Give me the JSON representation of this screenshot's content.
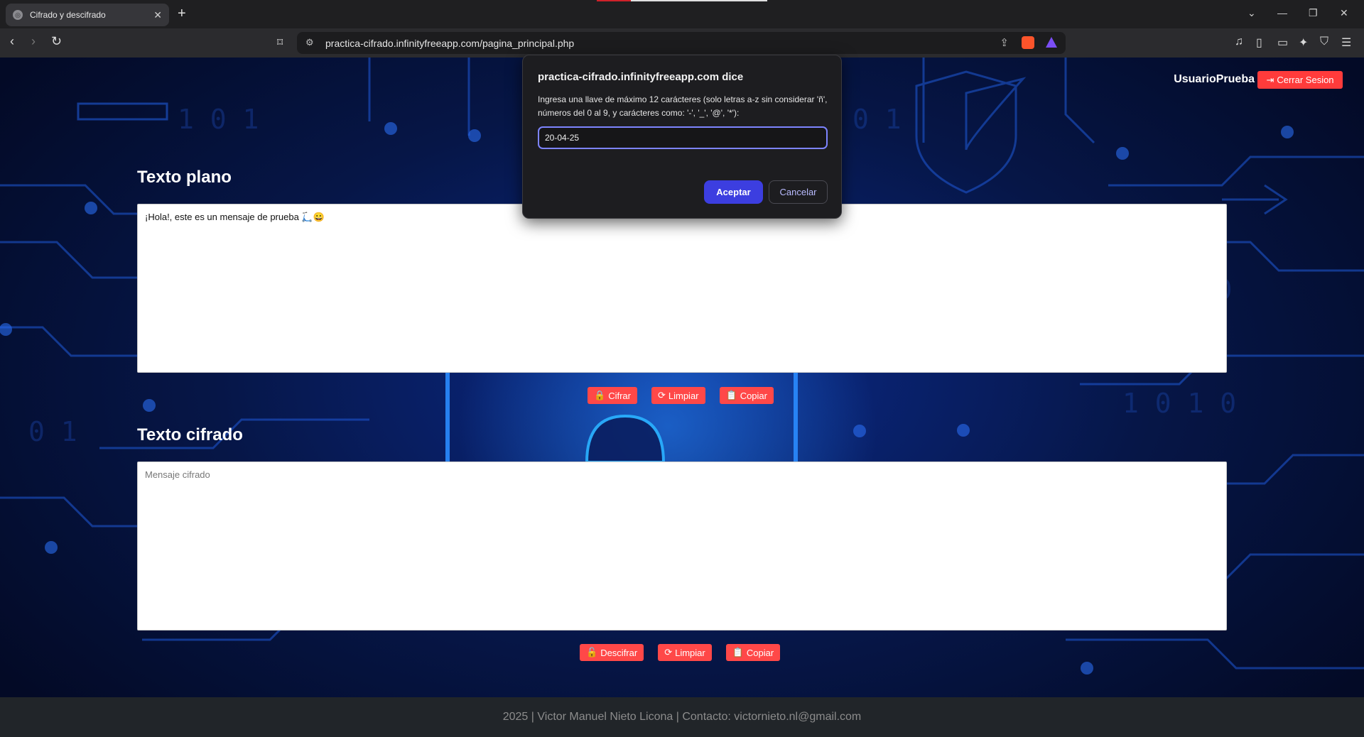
{
  "browser": {
    "tab_title": "Cifrado y descifrado",
    "url": "practica-cifrado.infinityfreeapp.com/pagina_principal.php"
  },
  "header": {
    "user_name": "UsuarioPrueba",
    "logout_label": "Cerrar Sesion"
  },
  "plain": {
    "title": "Texto plano",
    "text": "¡Hola!, este es un mensaje de prueba 🛴😀",
    "buttons": {
      "encrypt": "Cifrar",
      "clear": "Limpiar",
      "copy": "Copiar"
    }
  },
  "cipher": {
    "title": "Texto cifrado",
    "placeholder": "Mensaje cifrado",
    "buttons": {
      "decrypt": "Descifrar",
      "clear": "Limpiar",
      "copy": "Copiar"
    }
  },
  "footer": {
    "text": "2025 | Victor Manuel Nieto Licona | Contacto: victornieto.nl@gmail.com"
  },
  "dialog": {
    "title": "practica-cifrado.infinityfreeapp.com dice",
    "message": "Ingresa una llave de máximo 12 carácteres (solo letras a-z sin considerar 'ñ', números del 0 al 9, y carácteres como: '-', '_', '@', '*'):",
    "input_value": "20-04-25",
    "accept_label": "Aceptar",
    "cancel_label": "Cancelar"
  },
  "colors": {
    "accent_red": "#ff4848",
    "dialog_accent": "#3c3ee0"
  }
}
